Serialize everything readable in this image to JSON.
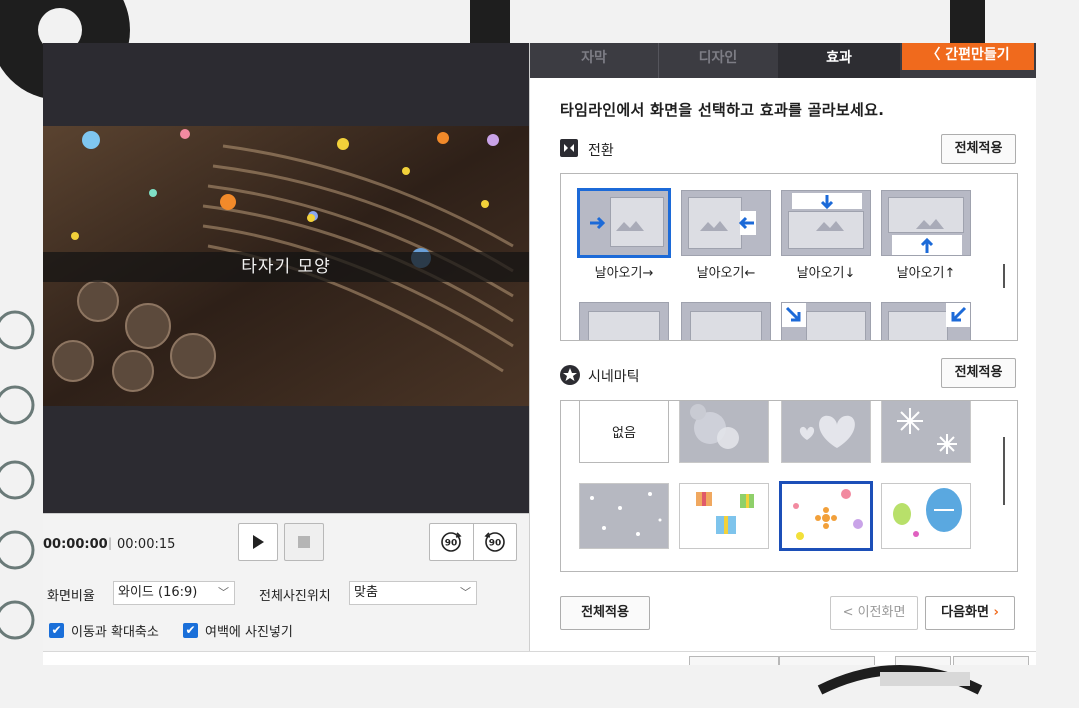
{
  "preview": {
    "caption": "타자기 모양"
  },
  "playback": {
    "current_time": "00:00:00",
    "separator": "|",
    "total_time": "00:00:15",
    "rotate_left_label": "90",
    "rotate_right_label": "90"
  },
  "settings": {
    "aspect_label": "화면비율",
    "aspect_value": "와이드 (16:9)",
    "photo_position_label": "전체사진위치",
    "photo_position_value": "맞춤",
    "move_zoom_label": "이동과 확대축소",
    "move_zoom_checked": true,
    "fill_margin_label": "여백에 사진넣기",
    "fill_margin_checked": true
  },
  "tabs": [
    {
      "label": "자막",
      "active": false
    },
    {
      "label": "디자인",
      "active": false
    },
    {
      "label": "효과",
      "active": true
    }
  ],
  "easy_make_label": "간편만들기",
  "instruction": "타임라인에서 화면을 선택하고 효과를 골라보세요.",
  "transition": {
    "title": "전환",
    "apply_all": "전체적용",
    "items": [
      {
        "label": "날아오기→",
        "icon": "arrow-right",
        "selected": true
      },
      {
        "label": "날아오기←",
        "icon": "arrow-left",
        "selected": false
      },
      {
        "label": "날아오기↓",
        "icon": "arrow-down",
        "selected": false
      },
      {
        "label": "날아오기↑",
        "icon": "arrow-up",
        "selected": false
      }
    ],
    "second_row_icons": [
      "plain",
      "plain",
      "arrow-down-right",
      "arrow-down-left"
    ]
  },
  "cinematic": {
    "title": "시네마틱",
    "apply_all": "전체적용",
    "none_label": "없음",
    "items": [
      "none",
      "bokeh",
      "hearts",
      "snowflakes",
      "dots",
      "gift-boxes",
      "flowers",
      "balloons"
    ],
    "selected": "flowers"
  },
  "footer": {
    "apply_all": "전체적용",
    "prev_label": "< 이전화면",
    "next_label": "다음화면"
  },
  "colors": {
    "accent_orange": "#f06a1d",
    "selection_blue": "#1c6ad8",
    "tab_bar": "#3c3c42",
    "preview_bg": "#2c2b31"
  }
}
